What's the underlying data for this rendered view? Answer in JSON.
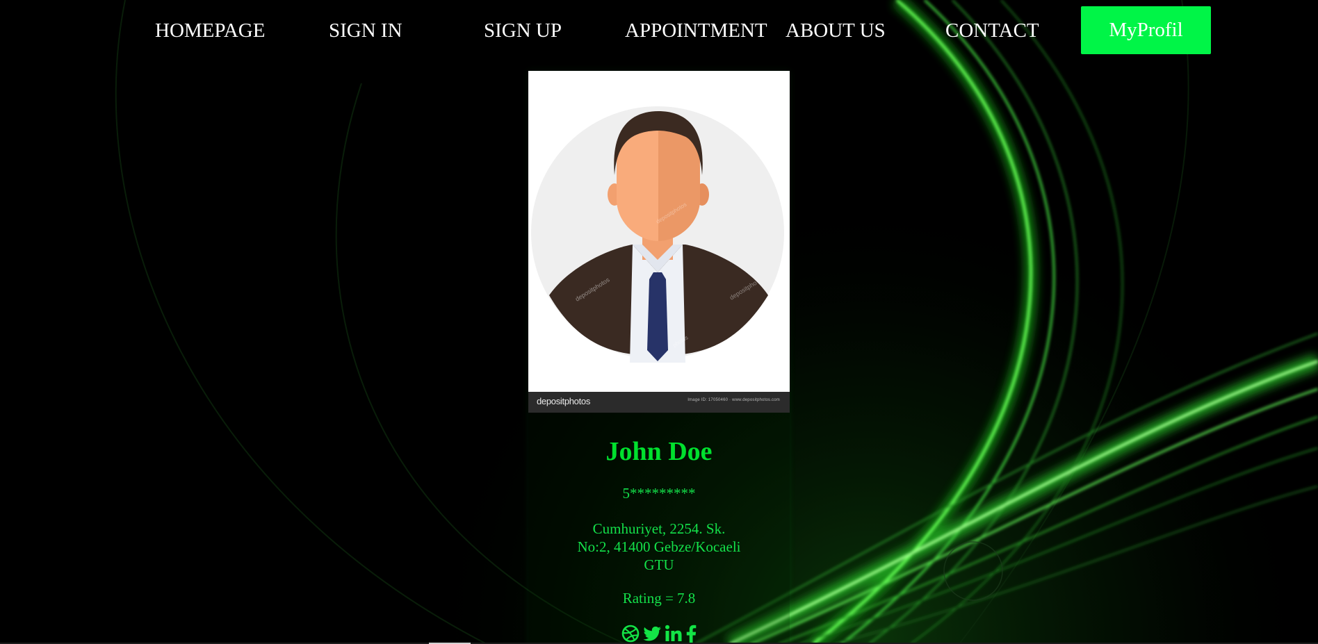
{
  "nav": {
    "links": [
      "HOMEPAGE",
      "SIGN IN",
      "SIGN UP",
      "APPOINTMENT",
      "ABOUT US",
      "CONTACT"
    ],
    "profile_label": "MyProfil"
  },
  "profile": {
    "photo_watermark_logo": "depositphotos",
    "photo_watermark_info": "Image ID: 17050460 · www.depositphotos.com",
    "name": "John Doe",
    "phone": "5*********",
    "address_line1": "Cumhuriyet, 2254. Sk.",
    "address_line2": "No:2, 41400 Gebze/Kocaeli",
    "address_line3": "GTU",
    "rating": "Rating = 7.8"
  },
  "socials": [
    "dribbble-icon",
    "twitter-icon",
    "linkedin-icon",
    "facebook-icon"
  ],
  "colors": {
    "accent": "#00f547",
    "name": "#00e02e",
    "text": "#14e14a",
    "background": "#000000"
  }
}
